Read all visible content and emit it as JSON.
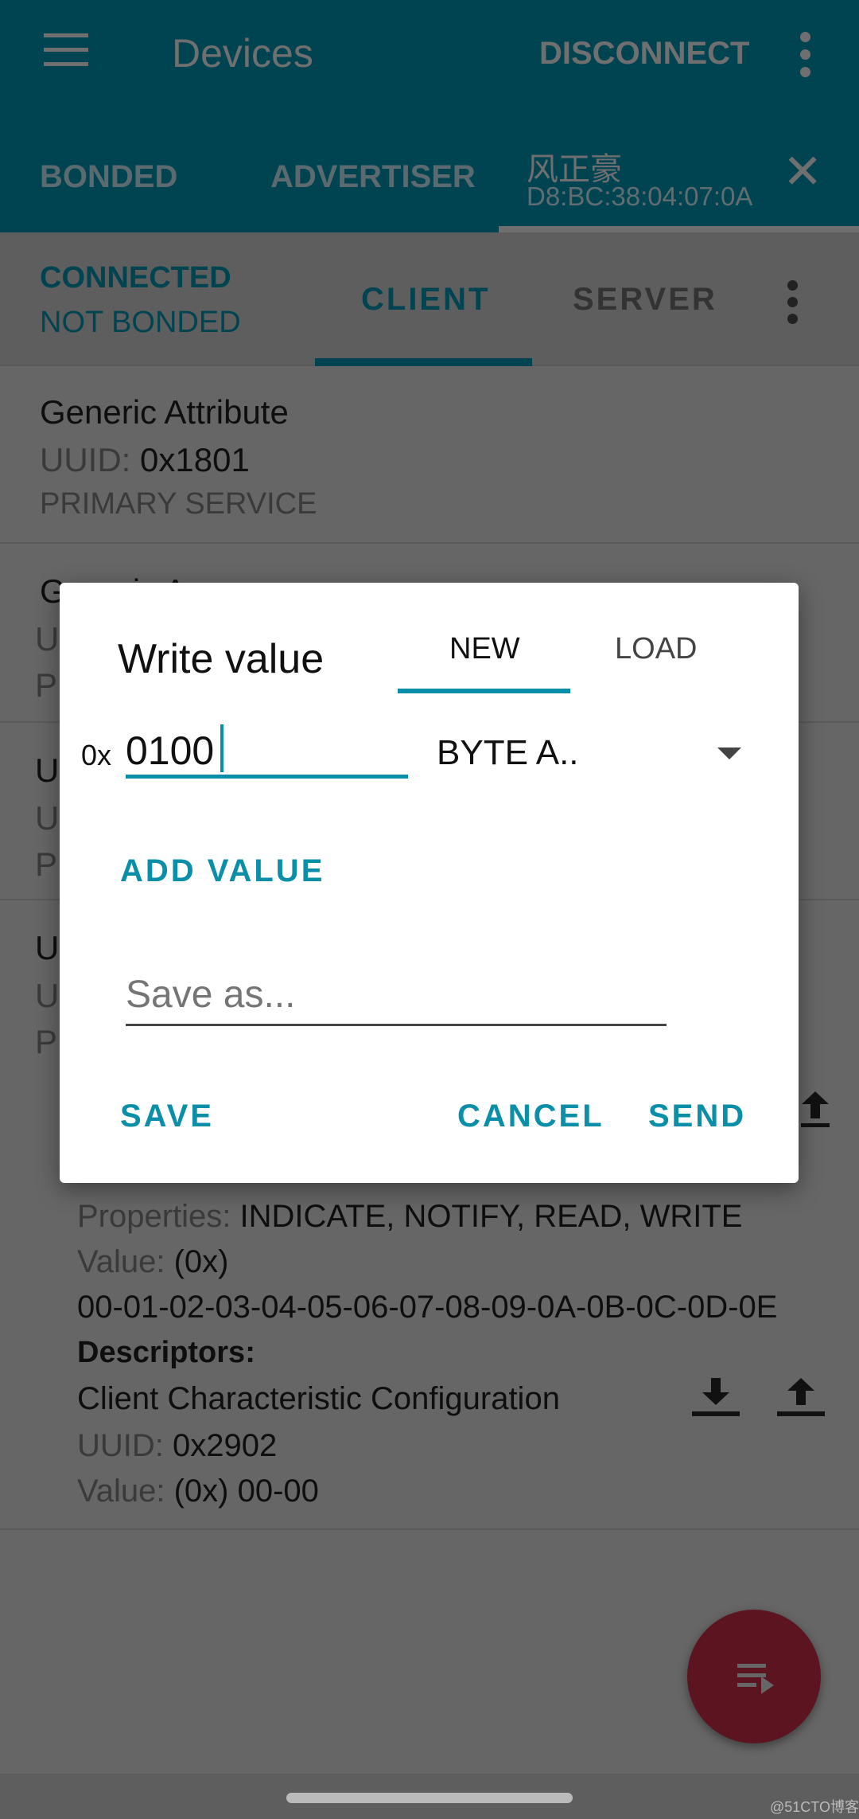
{
  "appbar": {
    "title": "Devices",
    "disconnect": "DISCONNECT",
    "tabs": [
      "BONDED",
      "ADVERTISER"
    ],
    "device_name": "风正豪",
    "device_address": "D8:BC:38:04:07:0A"
  },
  "subbar": {
    "state": "CONNECTED",
    "bond": "NOT BONDED",
    "tabs": [
      "CLIENT",
      "SERVER"
    ],
    "active_tab": "CLIENT"
  },
  "services": [
    {
      "title": "Generic Attribute",
      "uuid_label": "UUID:",
      "uuid": "0x1801",
      "type": "PRIMARY SERVICE"
    },
    {
      "title": "Generic A",
      "uuid_label": "U",
      "type": "P"
    },
    {
      "title": "U",
      "uuid_label": "U",
      "type": "P"
    },
    {
      "title": "U",
      "uuid_label": "U",
      "type": "P"
    }
  ],
  "characteristic": {
    "properties_label": "Properties:",
    "properties": "INDICATE, NOTIFY, READ, WRITE",
    "value_label": "Value:",
    "value_prefix": "(0x)",
    "value": "00-01-02-03-04-05-06-07-08-09-0A-0B-0C-0D-0E",
    "descriptors_label": "Descriptors:",
    "descriptor": {
      "name": "Client Characteristic Configuration",
      "uuid_label": "UUID:",
      "uuid": "0x2902",
      "value_label": "Value:",
      "value": "(0x) 00-00"
    }
  },
  "dialog": {
    "title": "Write value",
    "tabs": [
      "NEW",
      "LOAD"
    ],
    "active_tab": "NEW",
    "prefix": "0x",
    "value": "0100",
    "format": "BYTE A..",
    "add_value": "ADD VALUE",
    "save_as_placeholder": "Save as...",
    "save": "SAVE",
    "cancel": "CANCEL",
    "send": "SEND"
  },
  "watermark": "@51CTO博客",
  "colors": {
    "brand": "#00A9CE",
    "accent": "#0B8FA8",
    "fab": "#D0213A"
  }
}
